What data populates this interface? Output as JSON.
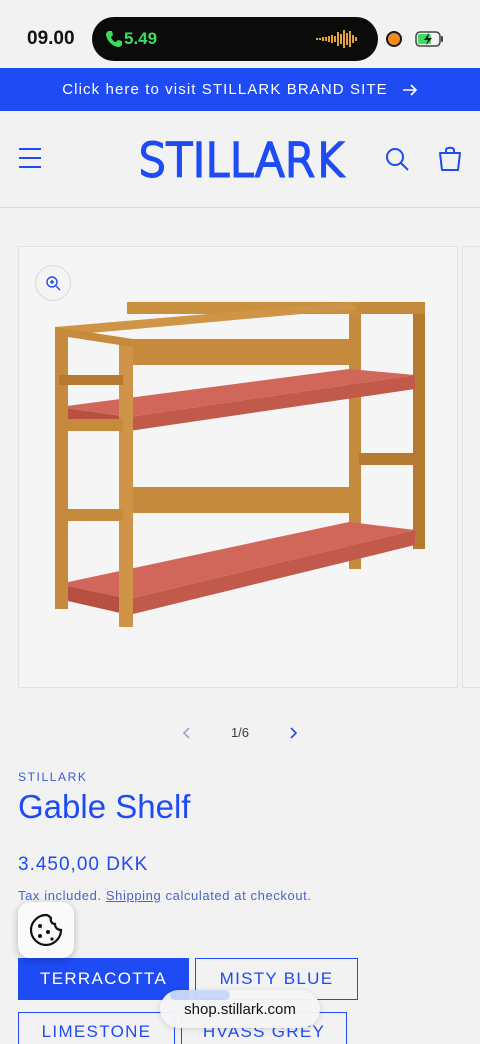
{
  "status_bar": {
    "time": "09.00",
    "call_time": "5.49"
  },
  "announcement": {
    "text": "Click here to visit STILLARK BRAND SITE"
  },
  "header": {
    "logo_text": "STILLARK",
    "icons": [
      "menu-icon",
      "search-icon",
      "cart-icon"
    ]
  },
  "gallery": {
    "counter": "1/6",
    "image_alt": "Gable Shelf product photo"
  },
  "product": {
    "vendor": "STILLARK",
    "title": "Gable Shelf",
    "price": "3.450,00 DKK",
    "tax_prefix": "Tax included.",
    "shipping_link": "Shipping",
    "tax_suffix": "calculated at checkout."
  },
  "variants": [
    {
      "label": "TERRACOTTA",
      "selected": true
    },
    {
      "label": "MISTY BLUE",
      "selected": false
    },
    {
      "label": "LIMESTONE",
      "selected": false
    },
    {
      "label": "HVASS GREY",
      "selected": false
    }
  ],
  "browser": {
    "url": "shop.stillark.com"
  },
  "colors": {
    "brand_blue": "#1f4bf5",
    "shelf_terracotta": "#c95a4c",
    "oak": "#c58a3c"
  }
}
